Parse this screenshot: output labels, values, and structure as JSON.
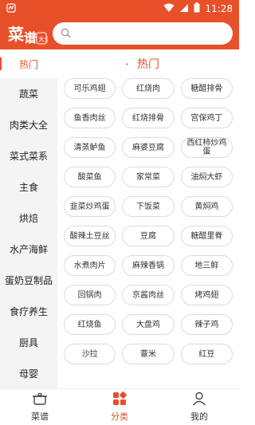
{
  "status": {
    "time": "11:28"
  },
  "search": {
    "placeholder": ""
  },
  "sidebar": {
    "items": [
      {
        "label": "热门"
      },
      {
        "label": "蔬菜"
      },
      {
        "label": "肉类大全"
      },
      {
        "label": "菜式菜系"
      },
      {
        "label": "主食"
      },
      {
        "label": "烘焙"
      },
      {
        "label": "水产海鲜"
      },
      {
        "label": "蛋奶豆制品"
      },
      {
        "label": "食疗养生"
      },
      {
        "label": "厨具"
      },
      {
        "label": "母婴"
      }
    ]
  },
  "main": {
    "title": "热门",
    "chips": [
      "可乐鸡翅",
      "红烧肉",
      "糖醋排骨",
      "鱼香肉丝",
      "红烧排骨",
      "宫保鸡丁",
      "清蒸鲈鱼",
      "麻婆豆腐",
      "西红柿炒鸡蛋",
      "酸菜鱼",
      "家常菜",
      "油焖大虾",
      "韭菜炒鸡蛋",
      "下饭菜",
      "黄焖鸡",
      "酸辣土豆丝",
      "豆腐",
      "糖醋里脊",
      "水煮肉片",
      "麻辣香锅",
      "地三鲜",
      "回锅肉",
      "京酱肉丝",
      "烤鸡翅",
      "红烧鱼",
      "大盘鸡",
      "辣子鸡",
      "沙拉",
      "薏米",
      "红豆"
    ]
  },
  "tabbar": {
    "tabs": [
      {
        "label": "菜谱"
      },
      {
        "label": "分类"
      },
      {
        "label": "我的"
      }
    ]
  },
  "colors": {
    "accent": "#e8502a"
  }
}
